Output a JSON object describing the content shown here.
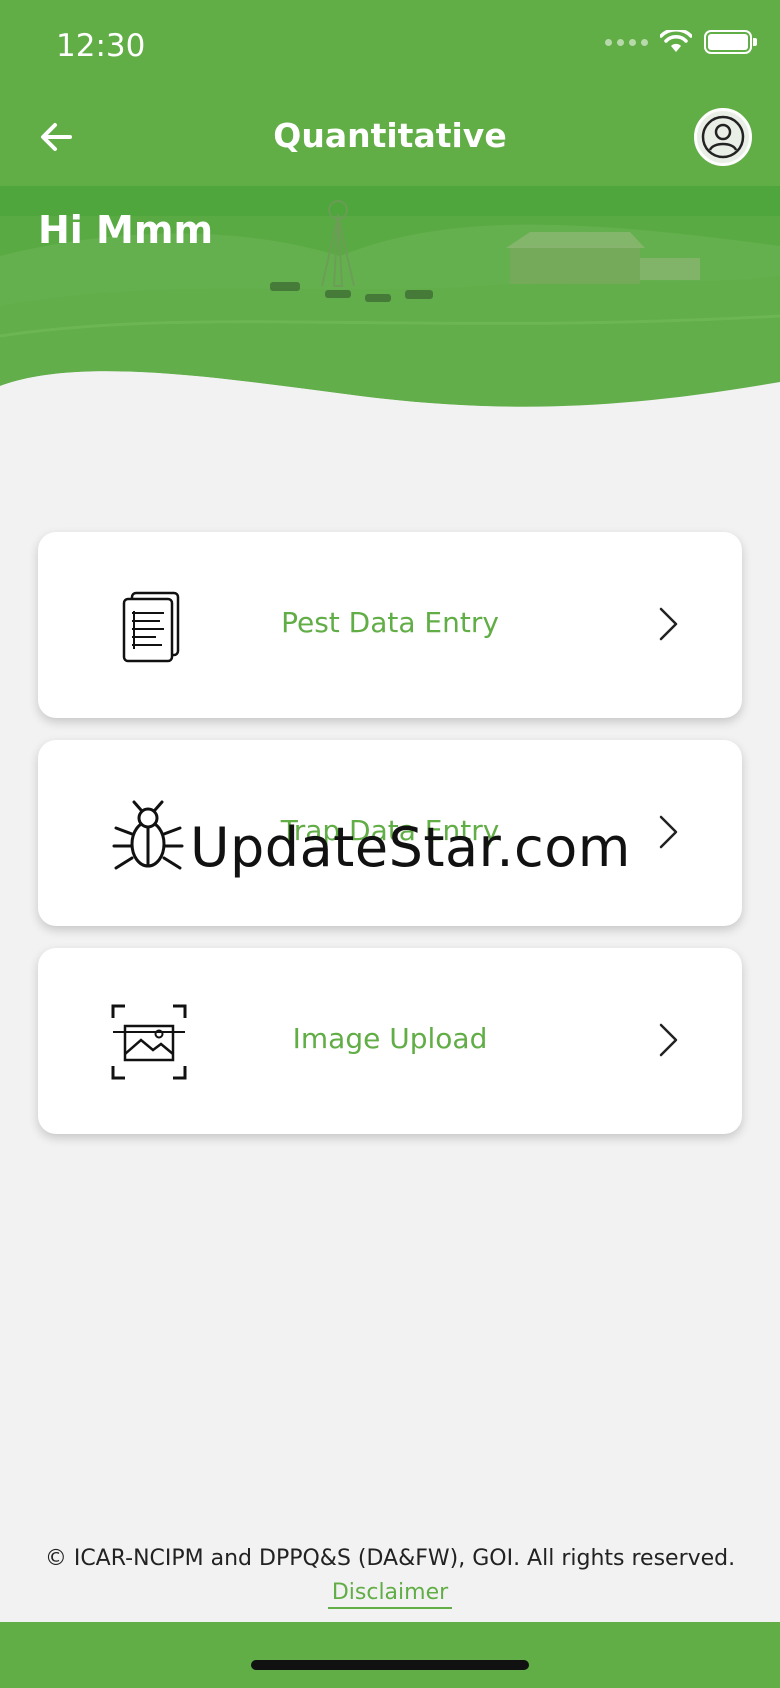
{
  "status_bar": {
    "time": "12:30"
  },
  "nav": {
    "title": "Quantitative"
  },
  "greeting": "Hi Mmm",
  "menu": [
    {
      "label": "Pest Data Entry",
      "icon": "document-icon"
    },
    {
      "label": "Trap Data Entry",
      "icon": "bug-icon"
    },
    {
      "label": "Image Upload",
      "icon": "image-scan-icon"
    }
  ],
  "watermark": "UpdateStar.com",
  "footer": {
    "copyright": "© ICAR-NCIPM and DPPQ&S (DA&FW), GOI. All rights reserved.",
    "disclaimer": "Disclaimer"
  },
  "colors": {
    "accent": "#61ad46",
    "background": "#f2f2f2"
  }
}
